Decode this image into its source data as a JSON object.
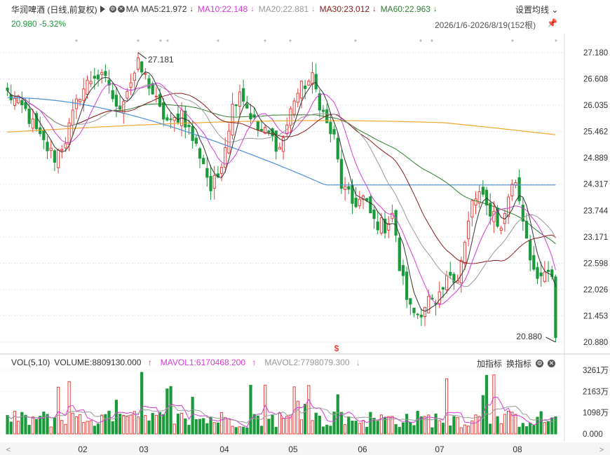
{
  "header": {
    "title": "华润啤酒 (日线,前复权)",
    "ma_label": "MA",
    "ma5": {
      "text": "MA5:21.972",
      "arrow": "↓",
      "color": "#333333"
    },
    "ma10": {
      "text": "MA10:22.148",
      "arrow": "↓",
      "color": "#d63ad6"
    },
    "ma20": {
      "text": "MA20:22.881",
      "arrow": "↓",
      "color": "#999999"
    },
    "ma30": {
      "text": "MA30:23.012",
      "arrow": "↓",
      "color": "#8b1a1a"
    },
    "ma60": {
      "text": "MA60:22.963",
      "arrow": "↓",
      "color": "#2e7d32"
    },
    "settings_label": "设置均线",
    "price_change": "20.980 -5.32%",
    "date_range": "2026/1/6-2026/8/19(152根)"
  },
  "volume_header": {
    "vol_label": "VOL(5,10)",
    "volume": "VOLUME:8809130.000",
    "volume_arrow": "↑",
    "mavol1": "MAVOL1:6170468.200",
    "mavol1_arrow": "↑",
    "mavol2": "MAVOL2:7798079.300",
    "mavol2_arrow": "↓",
    "add_indicator": "加指标",
    "change_indicator": "换指标"
  },
  "colors": {
    "up": "#e8413c",
    "down": "#1a9a3a",
    "ma250": "#f0a830",
    "ma120": "#4a8fd8"
  },
  "chart_data": {
    "type": "candlestick",
    "title": "华润啤酒 (日线,前复权)",
    "price_ticks": [
      "27.180",
      "26.608",
      "26.035",
      "25.462",
      "24.889",
      "24.317",
      "23.744",
      "23.171",
      "22.598",
      "22.026",
      "21.453",
      "20.880"
    ],
    "ylim": [
      20.88,
      27.18
    ],
    "volume_ticks": [
      "3261万",
      "2163万",
      "1098万",
      "0.000"
    ],
    "x_tick_labels": [
      "02",
      "03",
      "04",
      "05",
      "06",
      "07",
      "08"
    ],
    "annotations": [
      {
        "text": "27.181",
        "type": "high"
      },
      {
        "text": "20.880",
        "type": "low"
      }
    ],
    "last_close": 20.98,
    "change_pct": -5.32,
    "num_bars": 152,
    "anchors": [
      [
        0,
        26.3
      ],
      [
        5,
        25.9
      ],
      [
        9,
        25.3
      ],
      [
        13,
        24.9
      ],
      [
        16,
        25.3
      ],
      [
        20,
        26.3
      ],
      [
        24,
        26.7
      ],
      [
        28,
        26.5
      ],
      [
        30,
        25.9
      ],
      [
        33,
        26.4
      ],
      [
        36,
        26.9
      ],
      [
        39,
        26.5
      ],
      [
        42,
        25.9
      ],
      [
        45,
        25.6
      ],
      [
        48,
        25.9
      ],
      [
        51,
        25.3
      ],
      [
        54,
        24.8
      ],
      [
        56,
        24.2
      ],
      [
        58,
        24.5
      ],
      [
        60,
        25.2
      ],
      [
        62,
        26.0
      ],
      [
        64,
        26.4
      ],
      [
        66,
        26.0
      ],
      [
        69,
        25.5
      ],
      [
        72,
        25.4
      ],
      [
        75,
        25.1
      ],
      [
        77,
        25.6
      ],
      [
        79,
        26.2
      ],
      [
        82,
        26.5
      ],
      [
        84,
        26.6
      ],
      [
        86,
        26.1
      ],
      [
        88,
        25.6
      ],
      [
        90,
        25.3
      ],
      [
        92,
        24.3
      ],
      [
        95,
        23.9
      ],
      [
        98,
        24.0
      ],
      [
        101,
        23.5
      ],
      [
        104,
        23.4
      ],
      [
        106,
        23.7
      ],
      [
        108,
        22.5
      ],
      [
        111,
        21.6
      ],
      [
        113,
        21.5
      ],
      [
        116,
        21.8
      ],
      [
        118,
        21.6
      ],
      [
        120,
        22.0
      ],
      [
        122,
        22.4
      ],
      [
        124,
        22.3
      ],
      [
        126,
        23.0
      ],
      [
        128,
        23.9
      ],
      [
        130,
        24.1
      ],
      [
        132,
        23.8
      ],
      [
        134,
        23.7
      ],
      [
        136,
        23.3
      ],
      [
        138,
        24.1
      ],
      [
        140,
        24.4
      ],
      [
        142,
        23.6
      ],
      [
        144,
        22.8
      ],
      [
        146,
        22.1
      ],
      [
        148,
        22.4
      ],
      [
        150,
        22.2
      ],
      [
        151,
        20.98
      ]
    ],
    "volume_scale_max_wan": 3261
  }
}
